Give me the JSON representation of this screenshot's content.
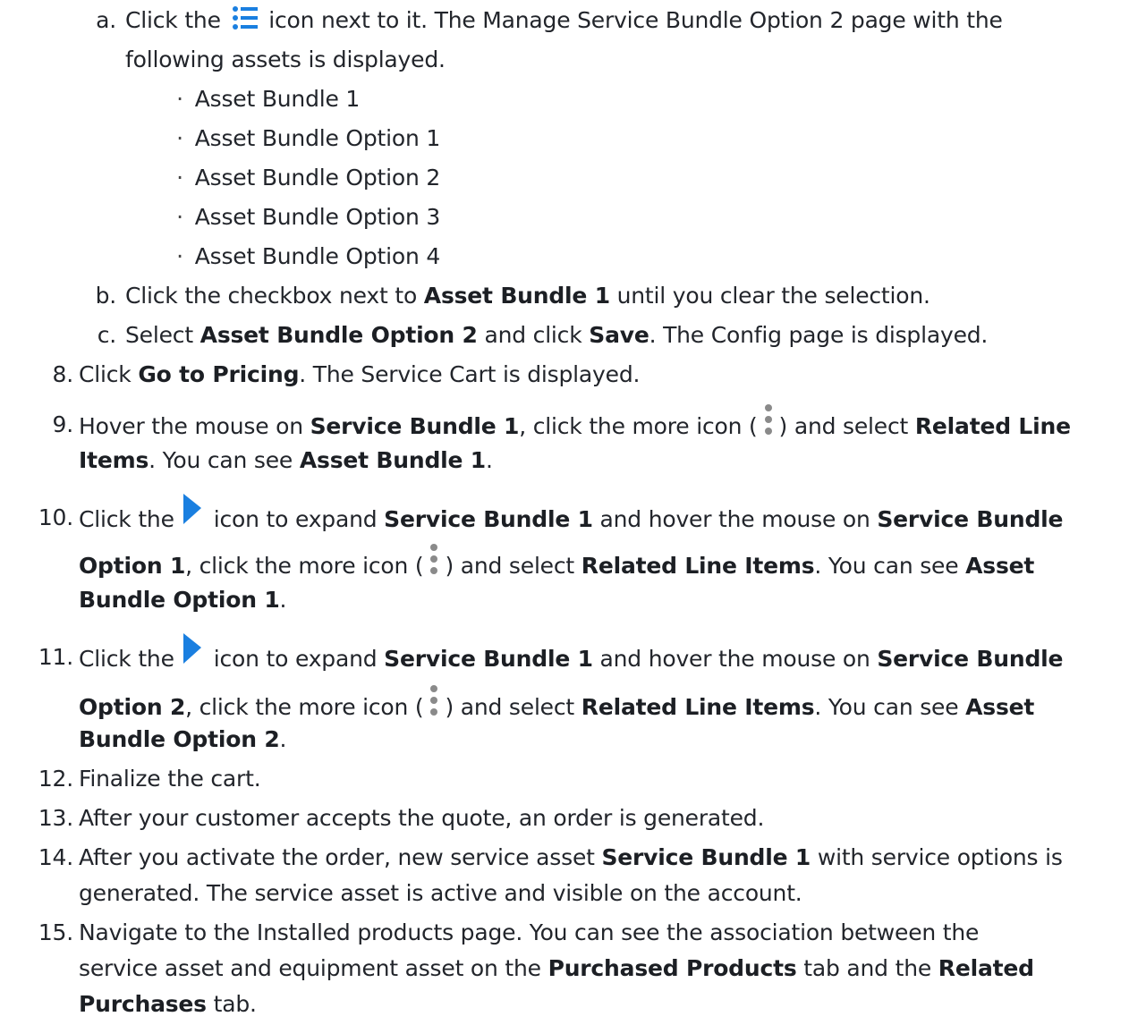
{
  "step7": {
    "a": {
      "marker": "a.",
      "text_before": "Click the",
      "icon": "list-icon",
      "text_after": "icon next to it. The Manage Service Bundle Option 2 page with the",
      "line2": "following assets is displayed.",
      "assets": [
        "Asset Bundle 1",
        "Asset Bundle Option 1",
        "Asset Bundle Option 2",
        "Asset Bundle Option 3",
        "Asset Bundle Option 4"
      ]
    },
    "b": {
      "marker": "b.",
      "t1": "Click the checkbox next to ",
      "b1": "Asset Bundle 1",
      "t2": " until you clear the selection."
    },
    "c": {
      "marker": "c.",
      "t1": "Select ",
      "b1": "Asset Bundle Option 2",
      "t2": " and click ",
      "b2": "Save",
      "t3": ". The Config page is displayed."
    }
  },
  "step8": {
    "num": "8.",
    "t1": "Click ",
    "b1": "Go to Pricing",
    "t2": ". The Service Cart is displayed."
  },
  "step9": {
    "num": "9.",
    "t1": "Hover the mouse on ",
    "b1": "Service Bundle 1",
    "t2": ", click the more icon (",
    "icon": "more-vertical-icon",
    "t3": ") and select ",
    "b2": "Related Line",
    "b3": "Items",
    "t4": ". You can see ",
    "b4": "Asset Bundle 1",
    "t5": "."
  },
  "step10": {
    "num": "10.",
    "t1": "Click the",
    "icon": "expand-arrow-icon",
    "t2": "icon to expand ",
    "b1": "Service Bundle 1",
    "t3": " and hover the mouse on ",
    "b2": "Service Bundle",
    "b3": "Option 1",
    "t4": ", click the more icon (",
    "t5": ") and select ",
    "b4": "Related Line Items",
    "t6": ". You can see ",
    "b5": "Asset",
    "b6": "Bundle Option 1",
    "t7": "."
  },
  "step11": {
    "num": "11.",
    "t1": "Click the",
    "icon": "expand-arrow-icon",
    "t2": "icon to expand ",
    "b1": "Service Bundle 1",
    "t3": " and hover the mouse on ",
    "b2": "Service Bundle",
    "b3": "Option 2",
    "t4": ", click the more icon (",
    "t5": ") and select ",
    "b4": "Related Line Items",
    "t6": ". You can see ",
    "b5": "Asset",
    "b6": "Bundle Option 2",
    "t7": "."
  },
  "step12": {
    "num": "12.",
    "text": "Finalize the cart."
  },
  "step13": {
    "num": "13.",
    "text": "After your customer accepts the quote, an order is generated."
  },
  "step14": {
    "num": "14.",
    "t1": "After you activate the order, new service asset ",
    "b1": "Service Bundle 1",
    "t2": " with service options is",
    "line2": "generated. The service asset is active and visible on the account."
  },
  "step15": {
    "num": "15.",
    "line1": "Navigate to the Installed products page. You can see the association between the",
    "t1": "service asset and equipment asset on the ",
    "b1": "Purchased Products",
    "t2": " tab and the ",
    "b2": "Related",
    "b3": "Purchases",
    "t3": " tab."
  },
  "colors": {
    "icon_blue": "#1a7fe0",
    "text": "#22252b",
    "more_icon_grey": "#8a8a8a"
  }
}
